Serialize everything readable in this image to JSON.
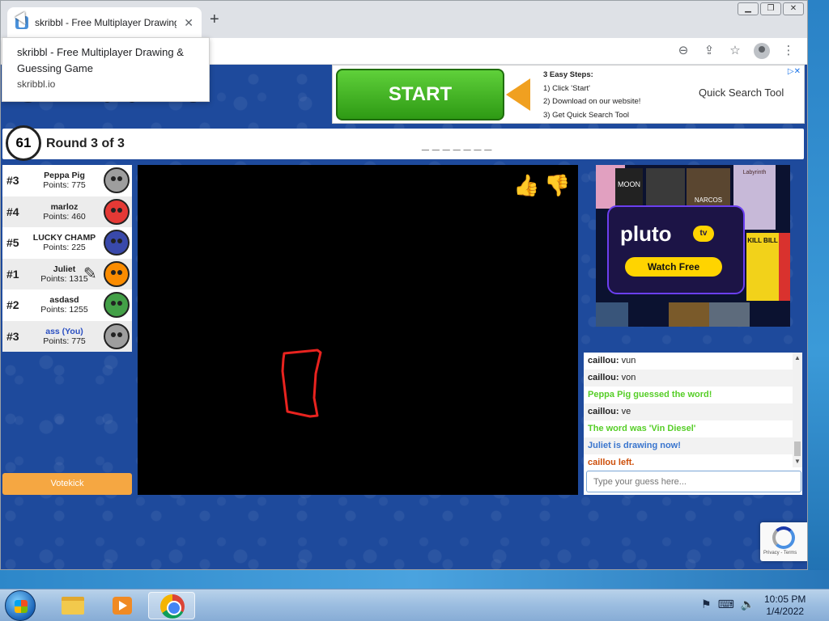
{
  "browser": {
    "tab_title": "skribbl - Free Multiplayer Drawing & Guessing Game",
    "tab_close": "✕",
    "new_tab": "+",
    "win_minimize": "▁",
    "win_restore": "❐",
    "win_close": "✕",
    "tooltip": {
      "title": "skribbl - Free Multiplayer Drawing & Guessing Game",
      "url": "skribbl.io"
    },
    "toolbar_icons": [
      "zoom-out-icon",
      "share-icon",
      "star-icon",
      "profile-icon",
      "menu-dots-icon"
    ]
  },
  "page": {
    "logo": "skribbl.io",
    "ad": {
      "start_label": "START",
      "steps_title": "3 Easy Steps:",
      "step1": "1) Click 'Start'",
      "step2": "2) Download on our website!",
      "step3": "3) Get Quick Search Tool",
      "tool_name": "Quick Search Tool",
      "close": "▷✕"
    },
    "round": {
      "timer": "61",
      "label": "Round 3 of 3",
      "word_hint": "_______"
    },
    "players": [
      {
        "rank": "#3",
        "name": "Peppa Pig",
        "points": "Points: 775",
        "face_color": "#9e9e9e",
        "you": false,
        "drawing": false
      },
      {
        "rank": "#4",
        "name": "marloz",
        "points": "Points: 460",
        "face_color": "#e53935",
        "you": false,
        "drawing": false
      },
      {
        "rank": "#5",
        "name": "LUCKY CHAMP",
        "points": "Points: 225",
        "face_color": "#3949ab",
        "you": false,
        "drawing": false
      },
      {
        "rank": "#1",
        "name": "Juliet",
        "points": "Points: 1315",
        "face_color": "#fb8c00",
        "you": false,
        "drawing": true
      },
      {
        "rank": "#2",
        "name": "asdasd",
        "points": "Points: 1255",
        "face_color": "#43a047",
        "you": false,
        "drawing": false
      },
      {
        "rank": "#3",
        "name": "ass (You)",
        "points": "Points: 775",
        "face_color": "#9e9e9e",
        "you": true,
        "drawing": false
      }
    ],
    "votekick": "Votekick",
    "side_ad": {
      "brand": "pluto",
      "brand_tv": "tv",
      "cta": "Watch Free",
      "poster1": "MOON",
      "poster2": "NARCOS",
      "poster3": "Labyrinth",
      "poster4": "KILL BILL"
    },
    "chat": {
      "messages": [
        {
          "kind": "msg",
          "user": "caillou:",
          "text": " vun"
        },
        {
          "kind": "msg",
          "user": "caillou:",
          "text": " von"
        },
        {
          "kind": "green",
          "text": "Peppa Pig guessed the word!"
        },
        {
          "kind": "msg",
          "user": "caillou:",
          "text": " ve"
        },
        {
          "kind": "green",
          "text": "The word was 'Vin Diesel'"
        },
        {
          "kind": "blue",
          "text": "Juliet is drawing now!"
        },
        {
          "kind": "red",
          "text": "caillou left."
        }
      ],
      "placeholder": "Type your guess here...",
      "scroll_up": "▲",
      "scroll_down": "▼"
    },
    "recaptcha": "Privacy - Terms"
  },
  "taskbar": {
    "time": "10:05 PM",
    "date": "1/4/2022",
    "tray_icons": [
      "flag-alert-icon",
      "network-icon",
      "volume-icon"
    ]
  }
}
